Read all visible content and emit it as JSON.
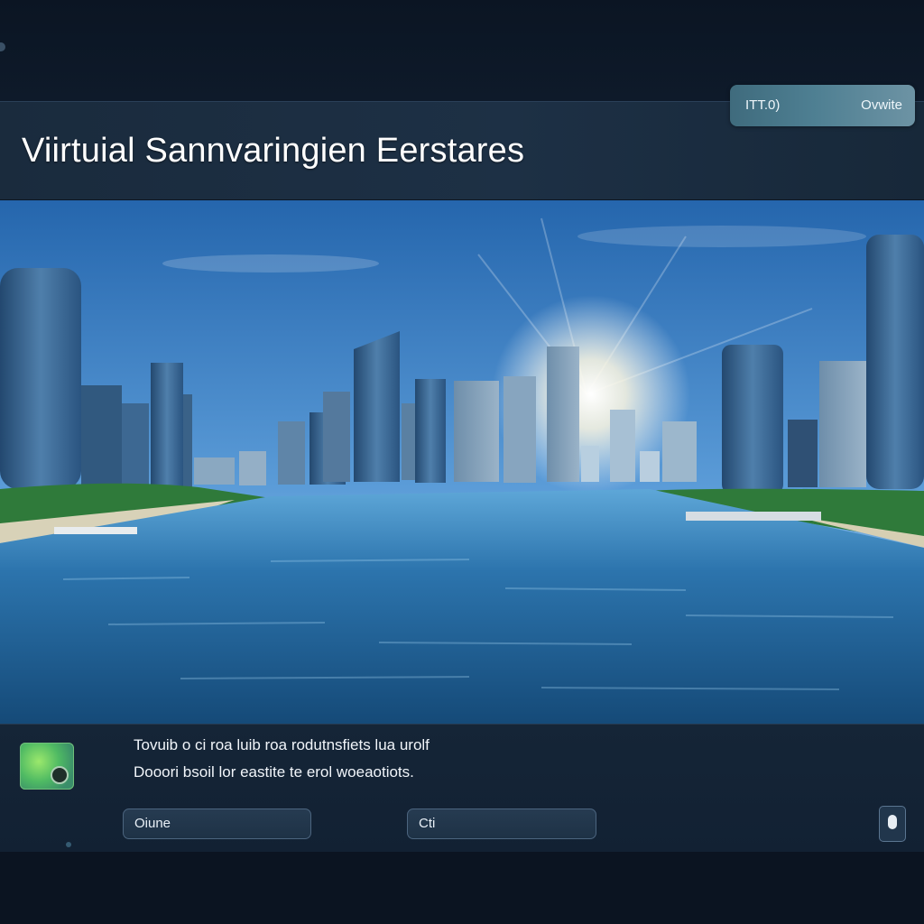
{
  "header": {
    "title": "Viirtuial Sannvaringien Eerstares",
    "pill_left": "ITT.0)",
    "pill_right": "Ovwite"
  },
  "scene": {
    "description_icon": "city-waterfront-image"
  },
  "footer": {
    "line1": "Tovuib o ci roa luib roa  rodutnsfiets lua urolf",
    "line2": "Dooori bsoil lor eastite te erol woeaotiots.",
    "button_a": "Oiune",
    "button_b": "Cti"
  },
  "icons": {
    "app_icon": "landscape-app-icon",
    "mic_icon": "microphone-icon"
  },
  "colors": {
    "accent_pill": "#4e7f92",
    "sky": "#3a83c8",
    "water": "#1f5f95"
  }
}
